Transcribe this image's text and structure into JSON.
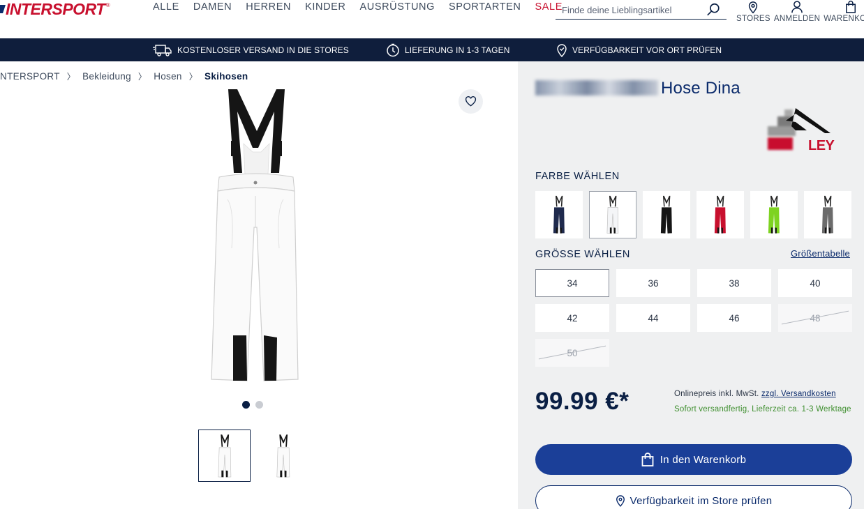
{
  "header": {
    "logo_text": "INTERSPORT",
    "nav": [
      "ALLE",
      "DAMEN",
      "HERREN",
      "KINDER",
      "AUSRÜSTUNG",
      "SPORTARTEN",
      "SALE"
    ],
    "search_placeholder": "Finde deine Lieblingsartikel",
    "stores_label": "STORES",
    "login_label": "ANMELDEN",
    "cart_label": "WARENKORB"
  },
  "servicebar": {
    "shipping": "KOSTENLOSER VERSAND IN DIE STORES",
    "delivery": "LIEFERUNG IN 1-3 TAGEN",
    "availability": "VERFÜGBARKEIT VOR ORT PRÜFEN"
  },
  "breadcrumb": [
    "INTERSPORT",
    "Bekleidung",
    "Hosen",
    "Skihosen"
  ],
  "gallery": {
    "image_count": 2,
    "active_index": 0
  },
  "product": {
    "title_suffix": "Hose Dina",
    "brand_logo_text": "LEY",
    "color_label": "FARBE WÄHLEN",
    "colors": [
      {
        "name": "navy",
        "hex": "#1f2a4d"
      },
      {
        "name": "white",
        "hex": "#f4f5f7"
      },
      {
        "name": "black",
        "hex": "#151515"
      },
      {
        "name": "red",
        "hex": "#c8102e"
      },
      {
        "name": "lime",
        "hex": "#7ed321"
      },
      {
        "name": "grey",
        "hex": "#6b6b6b"
      }
    ],
    "selected_color_index": 1,
    "size_label": "GRÖSSE WÄHLEN",
    "size_chart_link": "Größentabelle",
    "sizes": [
      {
        "label": "34",
        "available": true,
        "selected": true
      },
      {
        "label": "36",
        "available": true,
        "selected": false
      },
      {
        "label": "38",
        "available": true,
        "selected": false
      },
      {
        "label": "40",
        "available": true,
        "selected": false
      },
      {
        "label": "42",
        "available": true,
        "selected": false
      },
      {
        "label": "44",
        "available": true,
        "selected": false
      },
      {
        "label": "46",
        "available": true,
        "selected": false
      },
      {
        "label": "48",
        "available": false,
        "selected": false
      },
      {
        "label": "50",
        "available": false,
        "selected": false
      }
    ],
    "price": "99.99 €*",
    "price_note_prefix": "Onlinepreis inkl. MwSt.",
    "price_note_link": "zzgl. Versandkosten",
    "delivery_info": "Sofort versandfertig, Lieferzeit ca. 1-3 Werktage",
    "cart_button": "In den Warenkorb",
    "store_button": "Verfügbarkeit im Store prüfen"
  },
  "colors": {
    "brand_red": "#c8102e",
    "navy": "#0f1e3c",
    "button_blue": "#1b3f98",
    "panel_bg": "#eff0f1",
    "in_stock_green": "#3f8f2f"
  }
}
